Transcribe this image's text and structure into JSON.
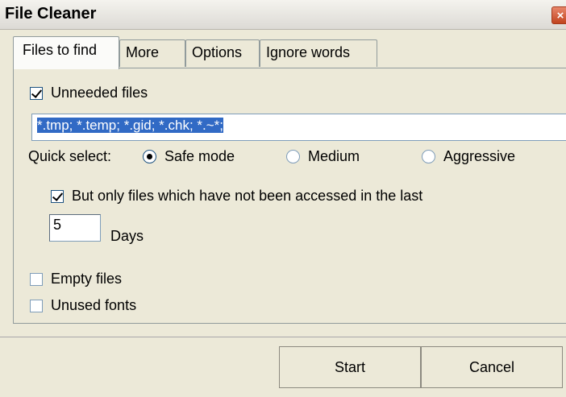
{
  "window": {
    "title": "File Cleaner",
    "close_glyph": "×"
  },
  "tabs": [
    {
      "label": "Files to find",
      "active": true
    },
    {
      "label": "More",
      "active": false
    },
    {
      "label": "Options",
      "active": false
    },
    {
      "label": "Ignore words",
      "active": false
    }
  ],
  "files": {
    "unneeded_label": "Unneeded files",
    "unneeded_checked": true,
    "pattern_value": "*.tmp; *.temp; *.gid; *.chk; *.~*;",
    "quick_select_label": "Quick select:",
    "modes": [
      {
        "label": "Safe mode",
        "selected": true
      },
      {
        "label": "Medium",
        "selected": false
      },
      {
        "label": "Aggressive",
        "selected": false
      }
    ],
    "accessed_label": "But only files which have not been accessed in the last",
    "accessed_checked": true,
    "days_value": "5",
    "days_label": "Days",
    "empty_label": "Empty files",
    "empty_checked": false,
    "fonts_label": "Unused fonts",
    "fonts_checked": false
  },
  "buttons": {
    "start": "Start",
    "cancel": "Cancel"
  },
  "colors": {
    "selection": "#316ac5",
    "close": "#c1441f",
    "face": "#ece9d8"
  }
}
